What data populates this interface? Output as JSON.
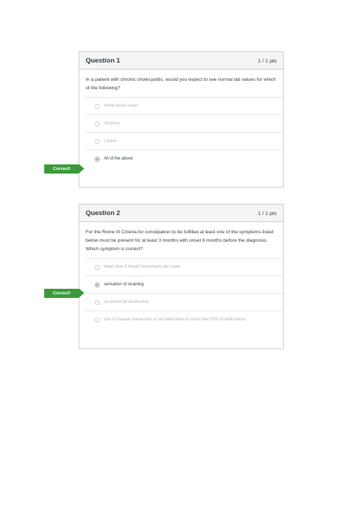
{
  "questions": [
    {
      "title": "Question 1",
      "points": "1 / 1 pts",
      "text": "In a patient with chronic cholecystitis, would you expect to see normal lab values for which of the following?",
      "answers": [
        "White blood count",
        "Amylase",
        "Lipase",
        "All of the above"
      ],
      "selected_index": 3,
      "correct_label": "Correct!"
    },
    {
      "title": "Question 2",
      "points": "1 / 1 pts",
      "text": "For the Rome III Criteria for constipation to be fulfilled at least one of the symptoms listed below must be present for at least 3 months with onset 6 months before the diagnosis.  Which symptom is correct?",
      "answers": [
        "fewer than 5 bowel movements per week",
        "sensation of straining",
        "no anorectal obstruction",
        "use of manual maneuvers to aid defecation in more than 50% of defecations"
      ],
      "selected_index": 1,
      "correct_label": "Correct!"
    }
  ],
  "colors": {
    "correct_tag": "#3a9a3a",
    "header_bg": "#f5f5f5",
    "border": "#c7cdd1",
    "muted_text": "#aab1b6"
  }
}
